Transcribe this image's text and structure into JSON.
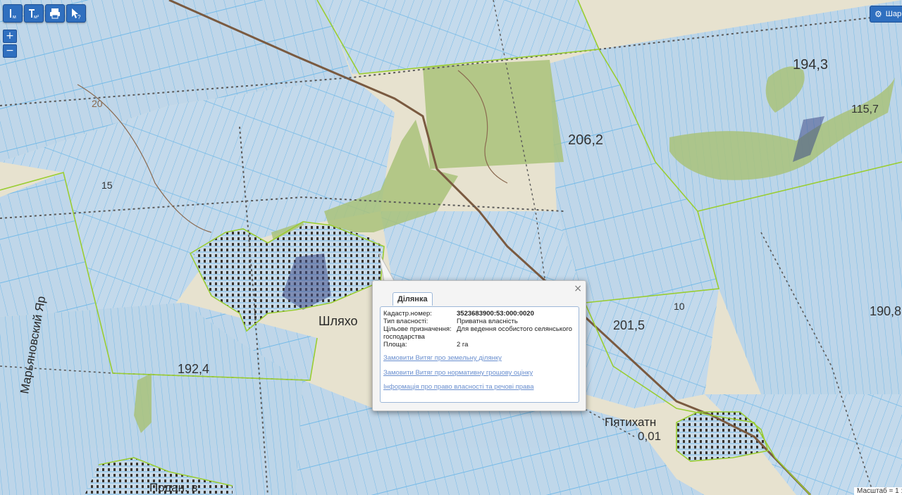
{
  "toolbar": {
    "tools": [
      {
        "name": "measure-line-icon",
        "label": "м"
      },
      {
        "name": "measure-area-icon",
        "label": "м²"
      },
      {
        "name": "print-icon"
      },
      {
        "name": "identify-icon",
        "label": "?"
      }
    ]
  },
  "zoom": {
    "in": "+",
    "out": "−"
  },
  "share": {
    "label": "Шари",
    "icon": "gear-icon"
  },
  "scale": {
    "label": "Масштаб = 1 :"
  },
  "map_labels": {
    "n1943": "194,3",
    "n2062": "206,2",
    "n1157": "115,7",
    "n2015": "201,5",
    "n1924": "192,4",
    "n1908": "190,8",
    "n001": "0,01",
    "n15": "15",
    "n20": "20",
    "n10": "10",
    "village1": "Шляхо",
    "village2": "Пятихатн",
    "village3": "Подан. в",
    "river": "Марьяновский Яр"
  },
  "popup": {
    "tab": "Ділянка",
    "close": "×",
    "fields": [
      {
        "key": "Кадастр.номер:",
        "value": "3523683900:53:000:0020",
        "bold": true
      },
      {
        "key": "Тип власності:",
        "value": "Приватна власність"
      },
      {
        "key": "Цільове призначення:",
        "value": "Для ведення особистого селянського господарства"
      },
      {
        "key": "Площа:",
        "value": "2 га"
      }
    ],
    "links": [
      "Замовити Витяг про земельну ділянку",
      "Замовити Витяг про нормативну грошову оцінку",
      "Інформація про право власності та речові права"
    ]
  },
  "colors": {
    "base": "#e7e2cf",
    "parcel_fill": "#b7d3ea",
    "parcel_line": "#7fc2ee",
    "boundary": "#9acd32",
    "forest": "#a9c27a",
    "road": "#7a5a40",
    "accent": "#2f6fbf"
  }
}
